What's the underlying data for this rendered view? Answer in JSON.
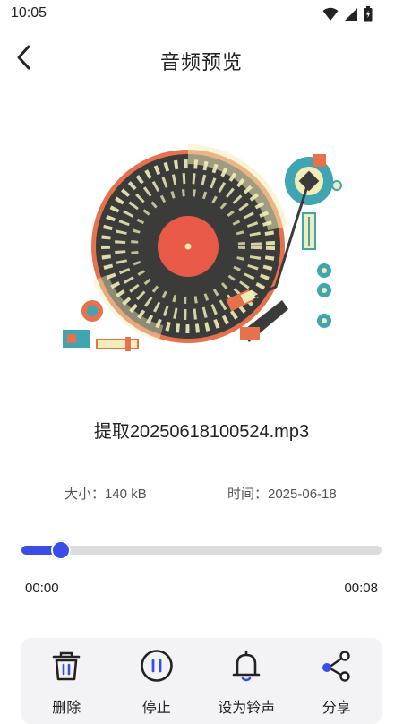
{
  "status_bar": {
    "time": "10:05",
    "icons": [
      "wifi-icon",
      "signal-icon",
      "battery-icon"
    ]
  },
  "app_bar": {
    "back_icon": "chevron-left-icon",
    "title": "音频预览"
  },
  "artwork": {
    "icon": "turntable-illustration",
    "colors": {
      "record": "#3b3c3a",
      "label": "#e85a47",
      "groove": "#f2ecb8",
      "teal": "#3fa5b3",
      "orange": "#e6714d"
    }
  },
  "file": {
    "name": "提取20250618100524.mp3",
    "size": "大小：140 kB",
    "time": "时间：2025-06-18"
  },
  "player": {
    "current_time": "00:00",
    "total_time": "00:08",
    "progress": 0.11,
    "accent": "#3a4de8"
  },
  "toolbar": {
    "items": [
      {
        "label": "删除",
        "icon": "trash-icon"
      },
      {
        "label": "停止",
        "icon": "pause-icon"
      },
      {
        "label": "设为铃声",
        "icon": "bell-icon"
      },
      {
        "label": "分享",
        "icon": "share-icon"
      }
    ]
  }
}
